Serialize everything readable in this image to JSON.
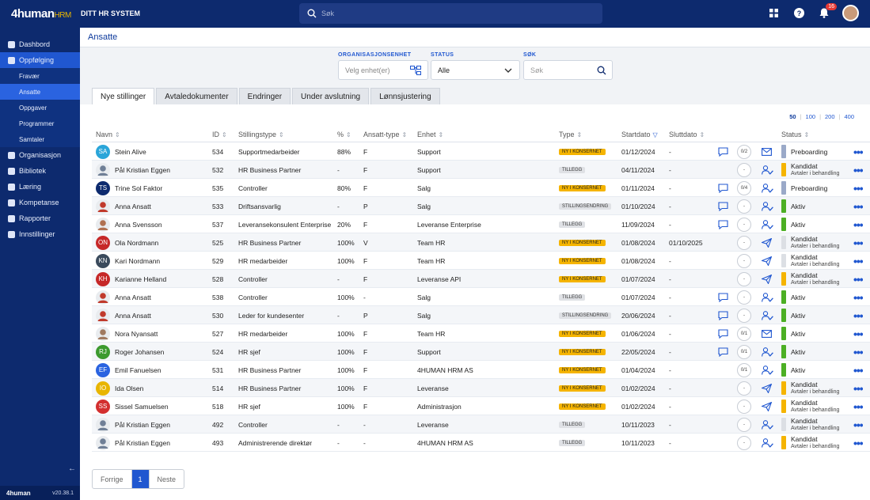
{
  "app": {
    "logo_main": "4human",
    "logo_sub": "HRM",
    "system_name": "DITT HR SYSTEM",
    "search_placeholder": "Søk",
    "notification_count": "16",
    "version": "v20.38.1",
    "footer_logo": "4human"
  },
  "sidebar": {
    "items": [
      {
        "label": "Dashbord",
        "icon": "dashboard-icon",
        "active": false
      },
      {
        "label": "Oppfølging",
        "icon": "clipboard-icon",
        "active": true
      },
      {
        "label": "Organisasjon",
        "icon": "people-icon",
        "active": false
      },
      {
        "label": "Bibliotek",
        "icon": "book-icon",
        "active": false
      },
      {
        "label": "Læring",
        "icon": "graduation-icon",
        "active": false
      },
      {
        "label": "Kompetanse",
        "icon": "badge-icon",
        "active": false
      },
      {
        "label": "Rapporter",
        "icon": "chart-icon",
        "active": false
      },
      {
        "label": "Innstillinger",
        "icon": "gear-icon",
        "active": false
      }
    ],
    "subitems": [
      {
        "label": "Fravær",
        "active": false
      },
      {
        "label": "Ansatte",
        "active": true
      },
      {
        "label": "Oppgaver",
        "active": false
      },
      {
        "label": "Programmer",
        "active": false
      },
      {
        "label": "Samtaler",
        "active": false
      }
    ]
  },
  "page": {
    "title": "Ansatte"
  },
  "filters": {
    "org_label": "ORGANISASJONSENHET",
    "org_placeholder": "Velg enhet(er)",
    "status_label": "STATUS",
    "status_value": "Alle",
    "search_label": "SØK",
    "search_placeholder": "Søk"
  },
  "tabs": [
    "Nye stillinger",
    "Avtaledokumenter",
    "Endringer",
    "Under avslutning",
    "Lønnsjustering"
  ],
  "page_sizes": [
    "50",
    "100",
    "200",
    "400"
  ],
  "table": {
    "headers": {
      "name": "Navn",
      "id": "ID",
      "position": "Stillingstype",
      "pct": "%",
      "emp_type": "Ansatt-type",
      "unit": "Enhet",
      "type": "Type",
      "start": "Startdato",
      "end": "Sluttdato",
      "status": "Status"
    },
    "rows": [
      {
        "initials": "SA",
        "avcolor": "#2aa5d9",
        "photo": false,
        "name": "Stein Alive",
        "id": "534",
        "position": "Supportmedarbeider",
        "pct": "88%",
        "emp": "F",
        "unit": "Support",
        "type": "NY I KONSERNET",
        "typekind": "konsern",
        "start": "01/12/2024",
        "end": "-",
        "chat": true,
        "count": "0/2",
        "action": "mail",
        "status": "Preboarding",
        "status_sub": "",
        "scolor": "#9aa9c8"
      },
      {
        "initials": "",
        "avcolor": "#6f7f96",
        "photo": true,
        "name": "Pål Kristian Eggen",
        "id": "532",
        "position": "HR Business Partner",
        "pct": "-",
        "emp": "F",
        "unit": "Support",
        "type": "TILLEGG",
        "typekind": "grey",
        "start": "04/11/2024",
        "end": "-",
        "chat": false,
        "count": "-",
        "action": "user",
        "status": "Kandidat",
        "status_sub": "Avtaler i behandling",
        "scolor": "#f5b400"
      },
      {
        "initials": "TS",
        "avcolor": "#0d2a6e",
        "photo": false,
        "name": "Trine Sol Faktor",
        "id": "535",
        "position": "Controller",
        "pct": "80%",
        "emp": "F",
        "unit": "Salg",
        "type": "NY I KONSERNET",
        "typekind": "konsern",
        "start": "01/11/2024",
        "end": "-",
        "chat": true,
        "count": "0/4",
        "action": "user",
        "status": "Preboarding",
        "status_sub": "",
        "scolor": "#9aa9c8"
      },
      {
        "initials": "",
        "avcolor": "#c0392b",
        "photo": true,
        "name": "Anna Ansatt",
        "id": "533",
        "position": "Driftsansvarlig",
        "pct": "-",
        "emp": "P",
        "unit": "Salg",
        "type": "STILLINGSENDRING",
        "typekind": "grey",
        "start": "01/10/2024",
        "end": "-",
        "chat": true,
        "count": "-",
        "action": "user",
        "status": "Aktiv",
        "status_sub": "",
        "scolor": "#4caf24"
      },
      {
        "initials": "",
        "avcolor": "#b07050",
        "photo": true,
        "name": "Anna Svensson",
        "id": "537",
        "position": "Leveransekonsulent Enterprise",
        "pct": "20%",
        "emp": "F",
        "unit": "Leveranse Enterprise",
        "type": "TILLEGG",
        "typekind": "grey",
        "start": "11/09/2024",
        "end": "-",
        "chat": true,
        "count": "-",
        "action": "user",
        "status": "Aktiv",
        "status_sub": "",
        "scolor": "#4caf24"
      },
      {
        "initials": "ON",
        "avcolor": "#c62828",
        "photo": false,
        "name": "Ola Nordmann",
        "id": "525",
        "position": "HR Business Partner",
        "pct": "100%",
        "emp": "V",
        "unit": "Team HR",
        "type": "NY I KONSERNET",
        "typekind": "konsern",
        "start": "01/08/2024",
        "end": "01/10/2025",
        "chat": false,
        "count": "-",
        "action": "send",
        "status": "Kandidat",
        "status_sub": "Avtaler i behandling",
        "scolor": "#dcdfe4"
      },
      {
        "initials": "KN",
        "avcolor": "#3a4a5c",
        "photo": false,
        "name": "Kari Nordmann",
        "id": "529",
        "position": "HR medarbeider",
        "pct": "100%",
        "emp": "F",
        "unit": "Team HR",
        "type": "NY I KONSERNET",
        "typekind": "konsern",
        "start": "01/08/2024",
        "end": "-",
        "chat": false,
        "count": "-",
        "action": "send",
        "status": "Kandidat",
        "status_sub": "Avtaler i behandling",
        "scolor": "#dcdfe4"
      },
      {
        "initials": "KH",
        "avcolor": "#c62828",
        "photo": false,
        "name": "Karianne Helland",
        "id": "528",
        "position": "Controller",
        "pct": "-",
        "emp": "F",
        "unit": "Leveranse API",
        "type": "NY I KONSERNET",
        "typekind": "konsern",
        "start": "01/07/2024",
        "end": "-",
        "chat": false,
        "count": "-",
        "action": "send",
        "status": "Kandidat",
        "status_sub": "Avtaler i behandling",
        "scolor": "#f5b400"
      },
      {
        "initials": "",
        "avcolor": "#c0392b",
        "photo": true,
        "name": "Anna Ansatt",
        "id": "538",
        "position": "Controller",
        "pct": "100%",
        "emp": "-",
        "unit": "Salg",
        "type": "TILLEGG",
        "typekind": "grey",
        "start": "01/07/2024",
        "end": "-",
        "chat": true,
        "count": "-",
        "action": "user",
        "status": "Aktiv",
        "status_sub": "",
        "scolor": "#4caf24"
      },
      {
        "initials": "",
        "avcolor": "#c0392b",
        "photo": true,
        "name": "Anna Ansatt",
        "id": "530",
        "position": "Leder for kundesenter",
        "pct": "-",
        "emp": "P",
        "unit": "Salg",
        "type": "STILLINGSENDRING",
        "typekind": "grey",
        "start": "20/06/2024",
        "end": "-",
        "chat": true,
        "count": "-",
        "action": "user",
        "status": "Aktiv",
        "status_sub": "",
        "scolor": "#4caf24"
      },
      {
        "initials": "",
        "avcolor": "#a07a60",
        "photo": true,
        "name": "Nora Nyansatt",
        "id": "527",
        "position": "HR medarbeider",
        "pct": "100%",
        "emp": "F",
        "unit": "Team HR",
        "type": "NY I KONSERNET",
        "typekind": "konsern",
        "start": "01/06/2024",
        "end": "-",
        "chat": true,
        "count": "0/1",
        "action": "mail",
        "status": "Aktiv",
        "status_sub": "",
        "scolor": "#4caf24"
      },
      {
        "initials": "RJ",
        "avcolor": "#3c9a2e",
        "photo": false,
        "name": "Roger Johansen",
        "id": "524",
        "position": "HR sjef",
        "pct": "100%",
        "emp": "F",
        "unit": "Support",
        "type": "NY I KONSERNET",
        "typekind": "konsern",
        "start": "22/05/2024",
        "end": "-",
        "chat": true,
        "count": "0/1",
        "action": "user",
        "status": "Aktiv",
        "status_sub": "",
        "scolor": "#4caf24"
      },
      {
        "initials": "EF",
        "avcolor": "#2a63e0",
        "photo": false,
        "name": "Emil Fanuelsen",
        "id": "531",
        "position": "HR Business Partner",
        "pct": "100%",
        "emp": "F",
        "unit": "4HUMAN HRM AS",
        "type": "NY I KONSERNET",
        "typekind": "konsern",
        "start": "01/04/2024",
        "end": "-",
        "chat": false,
        "count": "0/1",
        "action": "user",
        "status": "Aktiv",
        "status_sub": "",
        "scolor": "#4caf24"
      },
      {
        "initials": "IO",
        "avcolor": "#e8b500",
        "photo": false,
        "name": "Ida Olsen",
        "id": "514",
        "position": "HR Business Partner",
        "pct": "100%",
        "emp": "F",
        "unit": "Leveranse",
        "type": "NY I KONSERNET",
        "typekind": "konsern",
        "start": "01/02/2024",
        "end": "-",
        "chat": false,
        "count": "-",
        "action": "send",
        "status": "Kandidat",
        "status_sub": "Avtaler i behandling",
        "scolor": "#f5b400"
      },
      {
        "initials": "SS",
        "avcolor": "#d32f2f",
        "photo": false,
        "name": "Sissel Samuelsen",
        "id": "518",
        "position": "HR sjef",
        "pct": "100%",
        "emp": "F",
        "unit": "Administrasjon",
        "type": "NY I KONSERNET",
        "typekind": "konsern",
        "start": "01/02/2024",
        "end": "-",
        "chat": false,
        "count": "-",
        "action": "send",
        "status": "Kandidat",
        "status_sub": "Avtaler i behandling",
        "scolor": "#f5b400"
      },
      {
        "initials": "",
        "avcolor": "#6f7f96",
        "photo": true,
        "name": "Pål Kristian Eggen",
        "id": "492",
        "position": "Controller",
        "pct": "-",
        "emp": "-",
        "unit": "Leveranse",
        "type": "TILLEGG",
        "typekind": "grey",
        "start": "10/11/2023",
        "end": "-",
        "chat": false,
        "count": "-",
        "action": "user",
        "status": "Kandidat",
        "status_sub": "Avtaler i behandling",
        "scolor": "#dcdfe4"
      },
      {
        "initials": "",
        "avcolor": "#6f7f96",
        "photo": true,
        "name": "Pål Kristian Eggen",
        "id": "493",
        "position": "Administrerende direktør",
        "pct": "-",
        "emp": "-",
        "unit": "4HUMAN HRM AS",
        "type": "TILLEGG",
        "typekind": "grey",
        "start": "10/11/2023",
        "end": "-",
        "chat": false,
        "count": "-",
        "action": "user",
        "status": "Kandidat",
        "status_sub": "Avtaler i behandling",
        "scolor": "#f5b400"
      }
    ]
  },
  "pagination": {
    "prev": "Forrige",
    "current": "1",
    "next": "Neste"
  }
}
